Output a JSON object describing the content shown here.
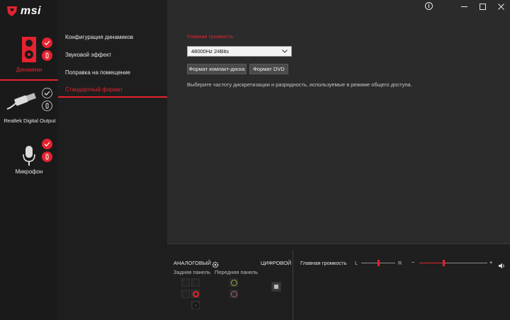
{
  "app": {
    "brand": "msi"
  },
  "devices": [
    {
      "label": "Динамики",
      "active": true,
      "icon": "speaker-icon"
    },
    {
      "label": "Realtek Digital Output",
      "active": false,
      "icon": "optical-cable-icon"
    },
    {
      "label": "Микрофон",
      "active": false,
      "icon": "microphone-icon"
    }
  ],
  "nav": {
    "items": [
      {
        "label": "Конфигурация динамиков"
      },
      {
        "label": "Звуковой эффект"
      },
      {
        "label": "Поправка на помещение"
      },
      {
        "label": "Стандартный формат"
      }
    ],
    "active_index": 3
  },
  "main": {
    "section_title": "Главная громкость",
    "format_select": {
      "value": "48000Hz 24Bits"
    },
    "buttons": {
      "cd": "Формат компакт-диска",
      "dvd": "Формат DVD"
    },
    "hint": "Выберите частоту дискретизации и разрядность, используемые в режиме общего доступа."
  },
  "bottom": {
    "analog_label": "АНАЛОГОВЫЙ",
    "digital_label": "ЦИФРОВОЙ",
    "rear_panel": "Задняя панель",
    "front_panel": "Передняя панель",
    "volume_label": "Главная громкость",
    "balance_left": "L",
    "balance_right": "R",
    "vol_minus": "−",
    "vol_plus": "+",
    "balance_value": 0.5,
    "volume_value": 0.36
  },
  "colors": {
    "accent": "#e4232f",
    "jack_green": "#9aa83a",
    "jack_pink": "#b05a86"
  }
}
